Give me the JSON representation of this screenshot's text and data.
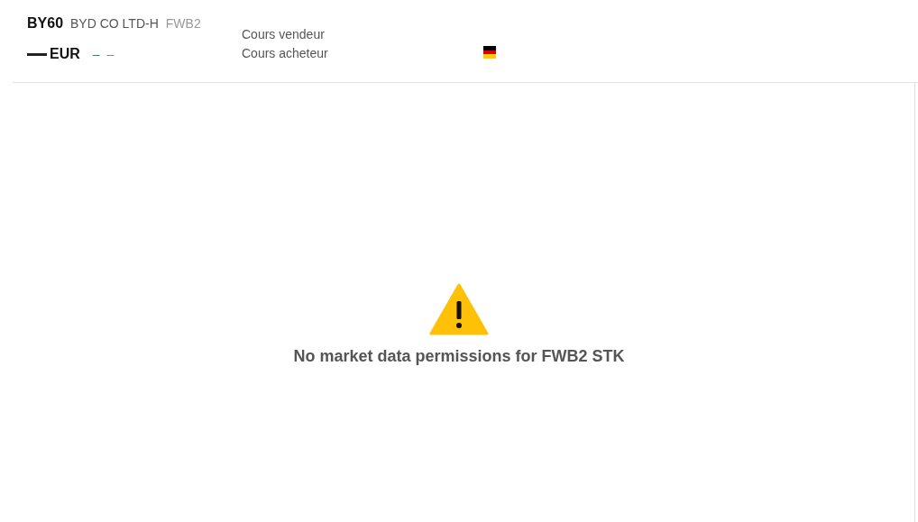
{
  "header": {
    "symbol": "BY60",
    "company": "BYD CO LTD-H",
    "exchange": "FWB2",
    "currency": "EUR",
    "change": "–",
    "change_pct": "–",
    "labels": [
      "Cours vendeur",
      "Cours acheteur"
    ]
  },
  "message": {
    "text": "No market data permissions for FWB2 STK"
  }
}
